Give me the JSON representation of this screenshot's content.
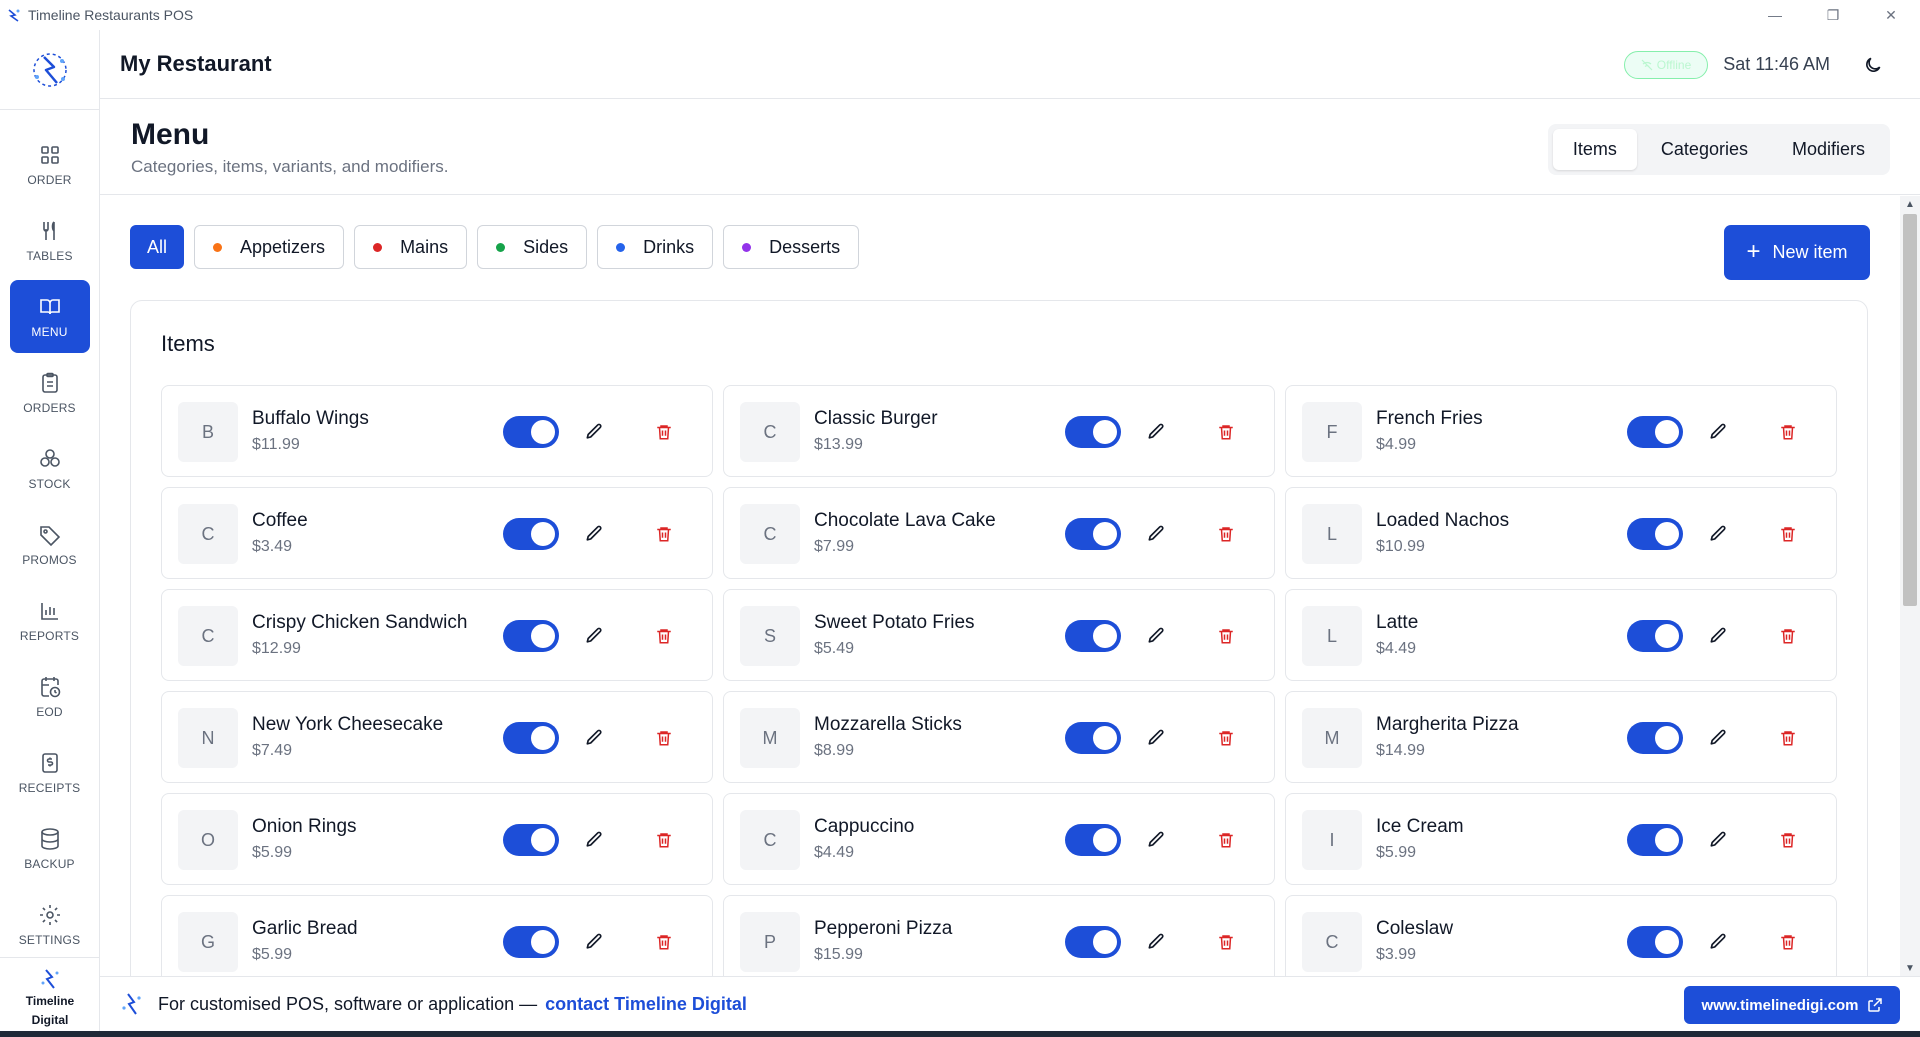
{
  "window": {
    "title": "Timeline Restaurants POS",
    "minimize": "—",
    "restore": "❐",
    "close": "✕"
  },
  "header": {
    "store_name": "My Restaurant",
    "status": "Offline",
    "clock": "Sat 11:46 AM"
  },
  "sidebar": {
    "items": [
      {
        "label": "ORDER",
        "icon": "grid-icon",
        "active": false
      },
      {
        "label": "TABLES",
        "icon": "utensils-icon",
        "active": false
      },
      {
        "label": "MENU",
        "icon": "book-open-icon",
        "active": true
      },
      {
        "label": "ORDERS",
        "icon": "clipboard-icon",
        "active": false
      },
      {
        "label": "STOCK",
        "icon": "boxes-icon",
        "active": false
      },
      {
        "label": "PROMOS",
        "icon": "tag-icon",
        "active": false
      },
      {
        "label": "REPORTS",
        "icon": "bar-chart-icon",
        "active": false
      },
      {
        "label": "EOD",
        "icon": "calendar-clock-icon",
        "active": false
      },
      {
        "label": "RECEIPTS",
        "icon": "receipt-icon",
        "active": false
      },
      {
        "label": "BACKUP",
        "icon": "database-icon",
        "active": false
      },
      {
        "label": "SETTINGS",
        "icon": "gear-icon",
        "active": false
      }
    ],
    "brand_line1": "Timeline",
    "brand_line2": "Digital"
  },
  "page": {
    "title": "Menu",
    "subtitle": "Categories, items, variants, and modifiers.",
    "tabs": [
      {
        "label": "Items",
        "active": true
      },
      {
        "label": "Categories",
        "active": false
      },
      {
        "label": "Modifiers",
        "active": false
      }
    ]
  },
  "filters": [
    {
      "label": "All",
      "active": true,
      "color": ""
    },
    {
      "label": "Appetizers",
      "active": false,
      "color": "#f97316"
    },
    {
      "label": "Mains",
      "active": false,
      "color": "#dc2626"
    },
    {
      "label": "Sides",
      "active": false,
      "color": "#16a34a"
    },
    {
      "label": "Drinks",
      "active": false,
      "color": "#2563eb"
    },
    {
      "label": "Desserts",
      "active": false,
      "color": "#9333ea"
    }
  ],
  "new_item_label": "New item",
  "panel_title": "Items",
  "items": [
    {
      "initial": "B",
      "name": "Buffalo Wings",
      "price": "$11.99",
      "enabled": true
    },
    {
      "initial": "C",
      "name": "Classic Burger",
      "price": "$13.99",
      "enabled": true
    },
    {
      "initial": "F",
      "name": "French Fries",
      "price": "$4.99",
      "enabled": true
    },
    {
      "initial": "C",
      "name": "Coffee",
      "price": "$3.49",
      "enabled": true
    },
    {
      "initial": "C",
      "name": "Chocolate Lava Cake",
      "price": "$7.99",
      "enabled": true
    },
    {
      "initial": "L",
      "name": "Loaded Nachos",
      "price": "$10.99",
      "enabled": true
    },
    {
      "initial": "C",
      "name": "Crispy Chicken Sandwich",
      "price": "$12.99",
      "enabled": true
    },
    {
      "initial": "S",
      "name": "Sweet Potato Fries",
      "price": "$5.49",
      "enabled": true
    },
    {
      "initial": "L",
      "name": "Latte",
      "price": "$4.49",
      "enabled": true
    },
    {
      "initial": "N",
      "name": "New York Cheesecake",
      "price": "$7.49",
      "enabled": true
    },
    {
      "initial": "M",
      "name": "Mozzarella Sticks",
      "price": "$8.99",
      "enabled": true
    },
    {
      "initial": "M",
      "name": "Margherita Pizza",
      "price": "$14.99",
      "enabled": true
    },
    {
      "initial": "O",
      "name": "Onion Rings",
      "price": "$5.99",
      "enabled": true
    },
    {
      "initial": "C",
      "name": "Cappuccino",
      "price": "$4.49",
      "enabled": true
    },
    {
      "initial": "I",
      "name": "Ice Cream",
      "price": "$5.99",
      "enabled": true
    },
    {
      "initial": "G",
      "name": "Garlic Bread",
      "price": "$5.99",
      "enabled": true
    },
    {
      "initial": "P",
      "name": "Pepperoni Pizza",
      "price": "$15.99",
      "enabled": true
    },
    {
      "initial": "C",
      "name": "Coleslaw",
      "price": "$3.99",
      "enabled": true
    }
  ],
  "footer": {
    "text": "For customised POS, software or application —",
    "link": "contact Timeline Digital",
    "site_button": "www.timelinedigi.com"
  },
  "colors": {
    "accent": "#1d4ed8",
    "danger": "#dc2626",
    "border": "#e5e7eb"
  }
}
